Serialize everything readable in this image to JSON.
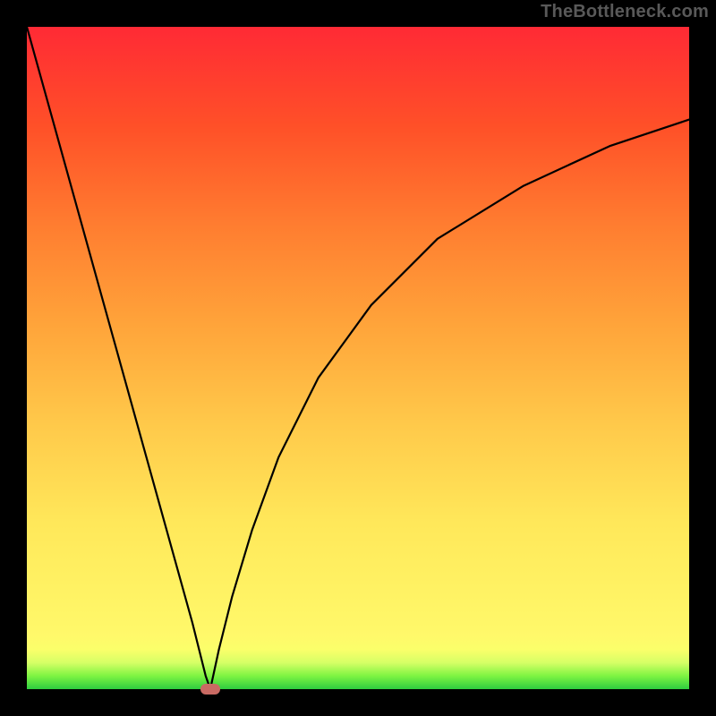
{
  "watermark": "TheBottleneck.com",
  "chart_data": {
    "type": "line",
    "title": "",
    "xlabel": "",
    "ylabel": "",
    "xlim": [
      0,
      100
    ],
    "ylim": [
      0,
      100
    ],
    "series": [
      {
        "name": "left-branch",
        "x": [
          0,
          5,
          10,
          15,
          20,
          25,
          26,
          27,
          27.7
        ],
        "y": [
          100,
          82,
          64,
          46,
          28,
          10,
          6,
          2,
          0
        ]
      },
      {
        "name": "right-branch",
        "x": [
          27.7,
          29,
          31,
          34,
          38,
          44,
          52,
          62,
          75,
          88,
          100
        ],
        "y": [
          0,
          6,
          14,
          24,
          35,
          47,
          58,
          68,
          76,
          82,
          86
        ]
      }
    ],
    "marker": {
      "x": 27.7,
      "y": 0,
      "shape": "pill",
      "color": "#c96a63"
    },
    "background_gradient": {
      "type": "vertical",
      "stops": [
        {
          "pos": 0,
          "color": "#2ecc40"
        },
        {
          "pos": 4,
          "color": "#d6ff66"
        },
        {
          "pos": 8,
          "color": "#fff96a"
        },
        {
          "pos": 40,
          "color": "#ffc94a"
        },
        {
          "pos": 70,
          "color": "#ff7d30"
        },
        {
          "pos": 100,
          "color": "#ff2a35"
        }
      ]
    }
  }
}
